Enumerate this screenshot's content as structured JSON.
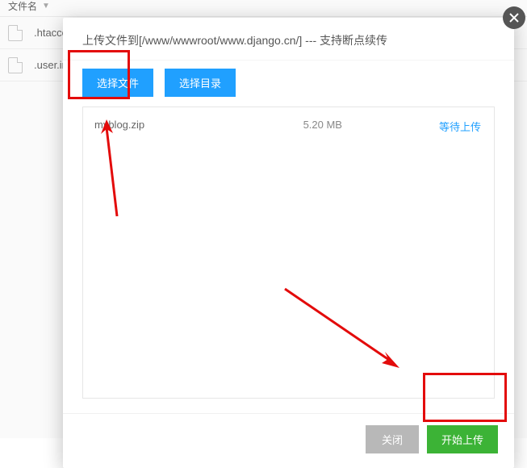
{
  "bgHeader": {
    "label": "文件名"
  },
  "bgFiles": [
    {
      "name": ".htaccess"
    },
    {
      "name": ".user.ini"
    }
  ],
  "modal": {
    "title": "上传文件到[/www/wwwroot/www.django.cn/] --- 支持断点续传",
    "selectFileBtn": "选择文件",
    "selectDirBtn": "选择目录",
    "closeBtn": "关闭",
    "startBtn": "开始上传"
  },
  "uploads": [
    {
      "name": "myblog.zip",
      "size": "5.20 MB",
      "status": "等待上传"
    }
  ]
}
